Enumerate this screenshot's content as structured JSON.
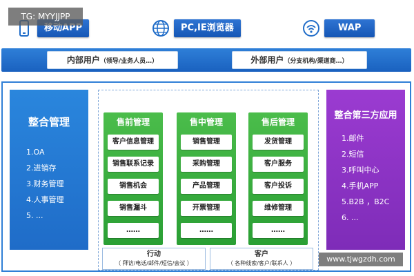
{
  "watermark_top": "TG: MYYJJPP",
  "watermark_bottom": "www.tjwgzdh.com",
  "access": [
    {
      "label": "移动APP",
      "icon": "mobile-phone-icon"
    },
    {
      "label": "PC,IE浏览器",
      "icon": "globe-icon"
    },
    {
      "label": "WAP",
      "icon": "wifi-icon"
    }
  ],
  "users": {
    "internal": {
      "label": "内部用户",
      "sub": "（领导/业务人员…）"
    },
    "external": {
      "label": "外部用户",
      "sub": "（分支机构/渠道商…）"
    }
  },
  "left_panel": {
    "title": "整合管理",
    "items": [
      "1.OA",
      "2.进销存",
      "3.财务管理",
      "4.人事管理",
      "5. ..."
    ]
  },
  "right_panel": {
    "title": "整合第三方应用",
    "items": [
      "1.邮件",
      "2.短信",
      "3.呼叫中心",
      "4.手机APP",
      "5.B2B ，B2C",
      "6. ..."
    ]
  },
  "columns": [
    {
      "title": "售前管理",
      "items": [
        "客户信息管理",
        "销售联系记录",
        "销售机会",
        "销售漏斗",
        "……"
      ]
    },
    {
      "title": "售中管理",
      "items": [
        "销售管理",
        "采购管理",
        "产品管理",
        "开票管理",
        "……"
      ]
    },
    {
      "title": "售后管理",
      "items": [
        "发货管理",
        "客户服务",
        "客户投诉",
        "维修管理",
        "……"
      ]
    }
  ],
  "bottom": {
    "action": {
      "title": "行动",
      "sub": "（ 拜访/电话/邮件/短信/会议 ）"
    },
    "customer": {
      "title": "客户",
      "sub": "（ 各种线索/客户/联系人 ）"
    }
  },
  "colors": {
    "primary_blue": "#1f6cc8",
    "green": "#2a9f34",
    "purple": "#7e2cb8"
  }
}
